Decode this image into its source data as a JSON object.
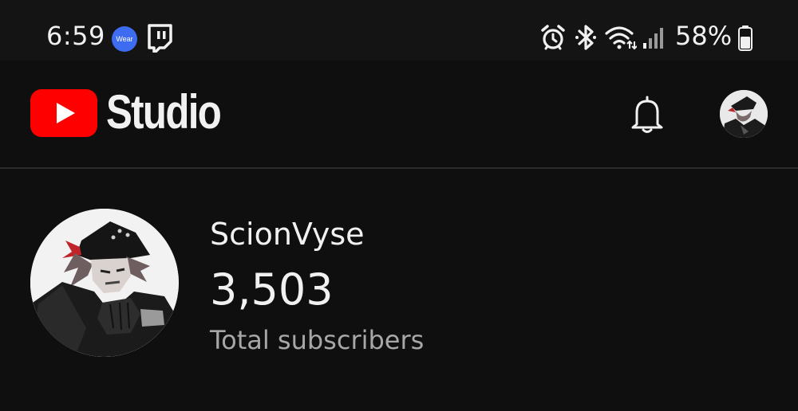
{
  "status_bar": {
    "time": "6:59",
    "wear_label": "Wear",
    "battery": "58%"
  },
  "header": {
    "app_name": "Studio",
    "icons": [
      "youtube-logo-icon",
      "bell-icon",
      "profile-avatar"
    ]
  },
  "channel": {
    "name": "ScionVyse",
    "subscriber_count": "3,503",
    "subscriber_label": "Total subscribers"
  },
  "colors": {
    "background": "#0f0f0f",
    "youtube_red": "#ff0000",
    "text_primary": "#f1f1f1",
    "text_secondary": "#a7a7a7",
    "wear_blue": "#3d6cf0"
  }
}
